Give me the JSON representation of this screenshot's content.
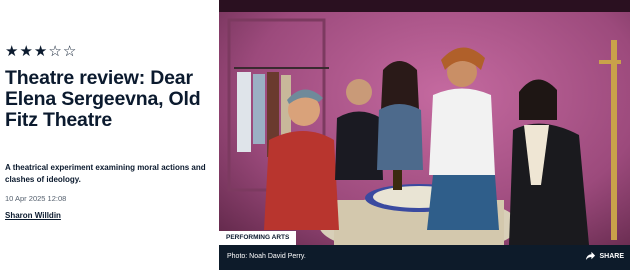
{
  "article": {
    "rating": {
      "value": 3,
      "max": 5
    },
    "headline": "Theatre review: Dear Elena Sergeevna, Old Fitz Theatre",
    "standfirst": "A theatrical experiment examining moral actions and clashes of ideology.",
    "date": "10 Apr 2025 12:08",
    "author": "Sharon Willdin"
  },
  "photo": {
    "category": "PERFORMING ARTS",
    "caption": "Photo: Noah David Perry.",
    "share_label": "SHARE"
  },
  "icons": {
    "star_filled": "star-filled-icon",
    "star_empty": "star-empty-icon",
    "share": "share-icon"
  },
  "colors": {
    "text": "#0b1a2e",
    "caption_bar": "#0d1b2a",
    "stage_wall": "#b45c8f"
  }
}
